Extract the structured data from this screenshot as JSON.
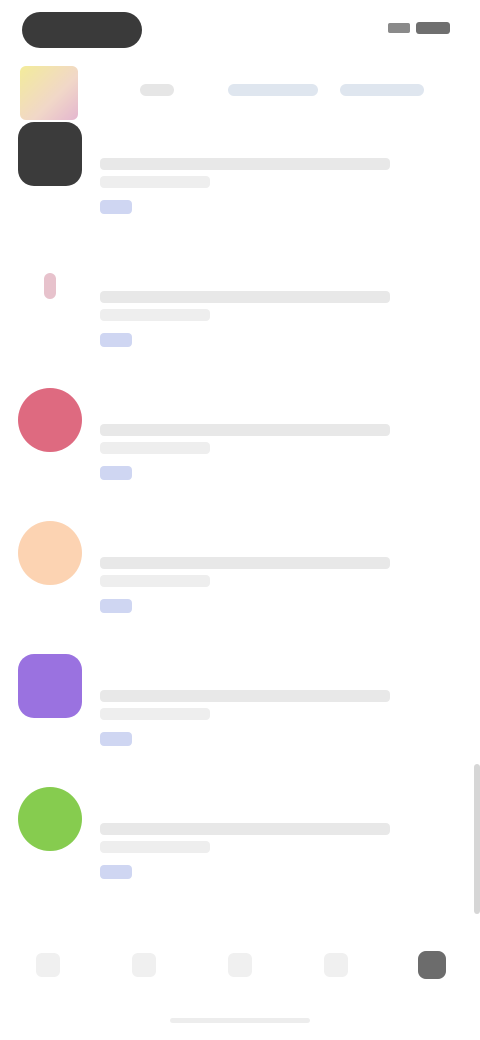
{
  "status_bar": {
    "time_pill": ""
  },
  "header": {
    "chips": [
      "",
      "",
      ""
    ]
  },
  "feed": {
    "items": [
      {
        "name": "",
        "icon": "app-icon-dark",
        "color": "#3b3b3b",
        "shape": "square"
      },
      {
        "name": "",
        "icon": "app-icon-pink-pin",
        "color": "#f4e4e8",
        "shape": "round"
      },
      {
        "name": "",
        "icon": "app-icon-red",
        "color": "#de6a80",
        "shape": "round"
      },
      {
        "name": "",
        "icon": "app-icon-peach",
        "color": "#fcd3b2",
        "shape": "round"
      },
      {
        "name": "",
        "icon": "app-icon-purple",
        "color": "#9a72e0",
        "shape": "square"
      },
      {
        "name": "",
        "icon": "app-icon-green",
        "color": "#86cc4f",
        "shape": "round"
      }
    ]
  },
  "tabbar": {
    "tabs": [
      {
        "icon": "home-icon",
        "active": false
      },
      {
        "icon": "discover-icon",
        "active": false
      },
      {
        "icon": "apps-icon",
        "active": false
      },
      {
        "icon": "updates-icon",
        "active": false
      },
      {
        "icon": "profile-icon",
        "active": true
      }
    ]
  },
  "colors": {
    "accent_tag": "#cfd6f2",
    "active_tab": "#6c6c6c"
  }
}
